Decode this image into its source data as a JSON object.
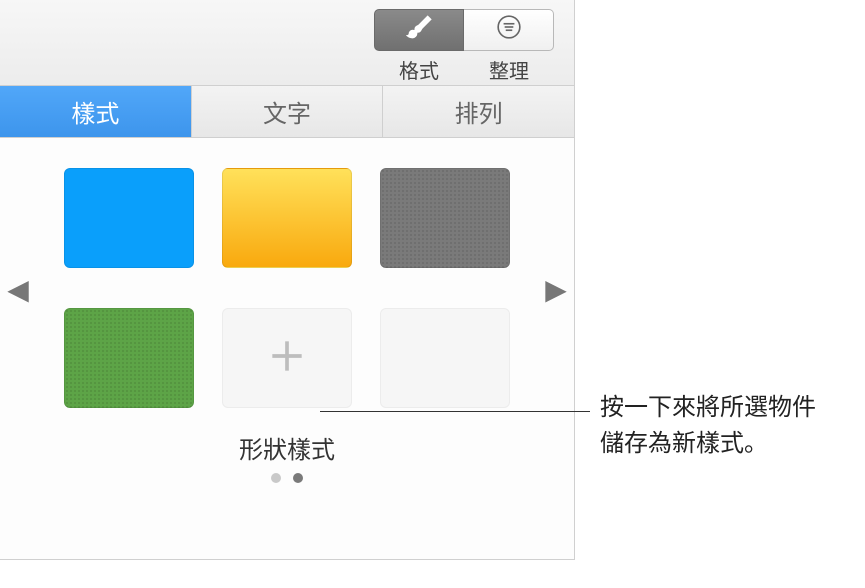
{
  "toolbar": {
    "format_label": "格式",
    "arrange_label": "整理"
  },
  "tabs": {
    "style": "樣式",
    "text": "文字",
    "arrange": "排列"
  },
  "styles": {
    "section_label": "形狀樣式",
    "swatches": [
      {
        "name": "blue",
        "class": "sw-blue"
      },
      {
        "name": "yellow",
        "class": "sw-yellow"
      },
      {
        "name": "gray",
        "class": "sw-gray"
      },
      {
        "name": "green",
        "class": "sw-green"
      }
    ],
    "pager": {
      "pages": 2,
      "active_index": 1
    }
  },
  "callout": {
    "line1": "按一下來將所選物件",
    "line2": "儲存為新樣式。"
  }
}
